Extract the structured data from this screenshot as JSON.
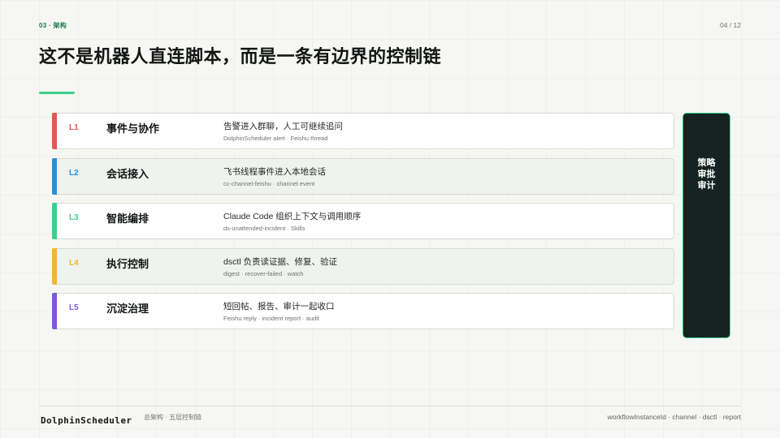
{
  "header": {
    "kicker": "03 · 架构",
    "page_number": "04 / 12",
    "title": "这不是机器人直连脚本，而是一条有边界的控制链"
  },
  "colors": {
    "accent": "#3ccf8e",
    "kicker": "#1e7a52",
    "policy_bg": "#142320",
    "L1": "#e05a54",
    "L2": "#2a8fd6",
    "L3": "#3ccf8e",
    "L4": "#f0b43a",
    "L5": "#7f5ad4"
  },
  "layers": [
    {
      "code": "L1",
      "name": "事件与协作",
      "desc": "告警进入群聊，人工可继续追问",
      "sub": "DolphinScheduler alert · Feishu thread"
    },
    {
      "code": "L2",
      "name": "会话接入",
      "desc": "飞书线程事件进入本地会话",
      "sub": "cc-channel-feishu · channel event"
    },
    {
      "code": "L3",
      "name": "智能编排",
      "desc": "Claude Code 组织上下文与调用顺序",
      "sub": "ds-unattended-incident · Skills"
    },
    {
      "code": "L4",
      "name": "执行控制",
      "desc": "dsctl 负责读证据、修复、验证",
      "sub": "digest · recover-failed · watch"
    },
    {
      "code": "L5",
      "name": "沉淀治理",
      "desc": "短回帖、报告、审计一起收口",
      "sub": "Feishu reply · incident report · audit"
    }
  ],
  "policy": {
    "line1": "策略",
    "line2": "审批",
    "line3": "审计"
  },
  "footer": {
    "brand": "DolphinScheduler",
    "caption": "总架构 · 五层控制链",
    "right": "workflowInstanceId · channel · dsctl · report"
  }
}
